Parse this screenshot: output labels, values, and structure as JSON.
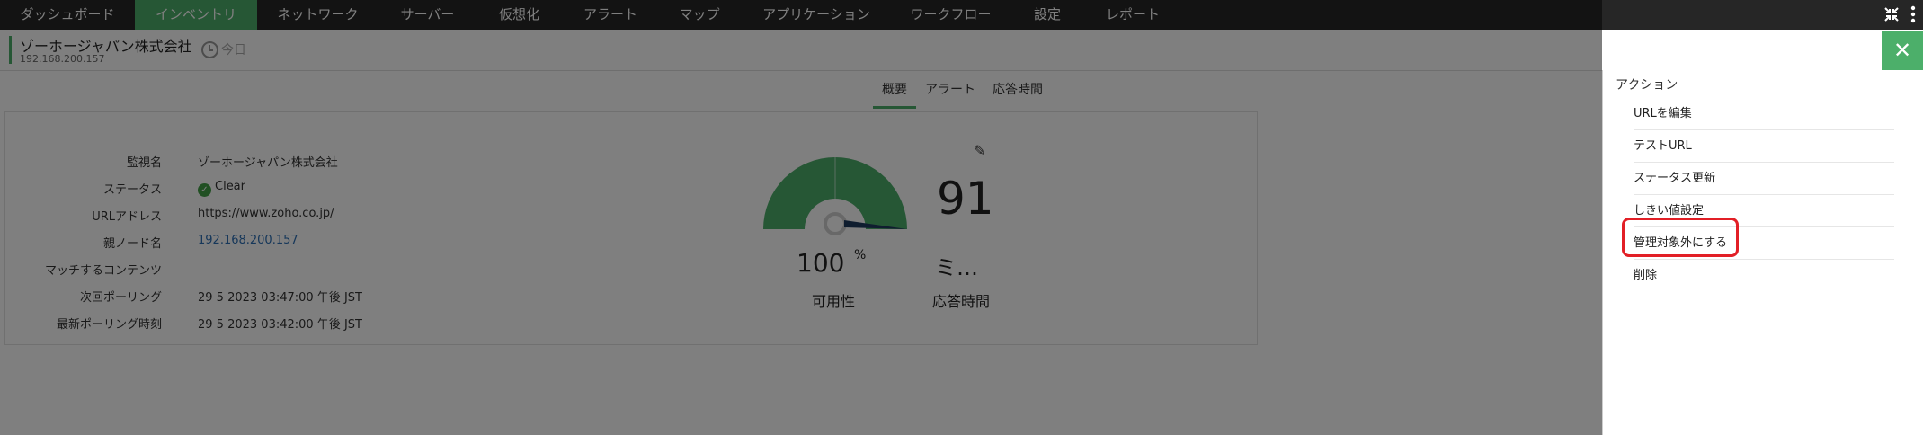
{
  "nav": {
    "items": [
      "ダッシュボード",
      "インベントリ",
      "ネットワーク",
      "サーバー",
      "仮想化",
      "アラート",
      "マップ",
      "アプリケーション",
      "ワークフロー",
      "設定",
      "レポート"
    ],
    "active_index": 1
  },
  "header": {
    "monitor_name": "ゾーホージャパン株式会社",
    "ip": "192.168.200.157",
    "time_label": "今日"
  },
  "tabs": [
    "概要",
    "アラート",
    "応答時間"
  ],
  "details": {
    "labels": [
      "監視名",
      "ステータス",
      "URLアドレス",
      "親ノード名",
      "マッチするコンテンツ",
      "次回ポーリング",
      "最新ポーリング時刻"
    ],
    "values": [
      "ゾーホージャパン株式会社",
      "Clear",
      "https://www.zoho.co.jp/",
      "192.168.200.157",
      "",
      "29 5 2023 03:47:00 午後 JST",
      "29 5 2023 03:42:00 午後 JST"
    ]
  },
  "availability": {
    "value": "100",
    "unit": "%",
    "label": "可用性",
    "gauge_fraction": 1.0
  },
  "response": {
    "value": "91",
    "unit": "ミ…",
    "label": "応答時間"
  },
  "panel": {
    "title": "アクション",
    "actions": [
      "URLを編集",
      "テストURL",
      "ステータス更新",
      "しきい値設定",
      "管理対象外にする",
      "削除"
    ],
    "highlighted_index": 4
  },
  "colors": {
    "accent": "#4caf6a",
    "nav_bg": "#262626",
    "highlight": "#e21f26",
    "gauge_needle": "#1f3a5f"
  }
}
